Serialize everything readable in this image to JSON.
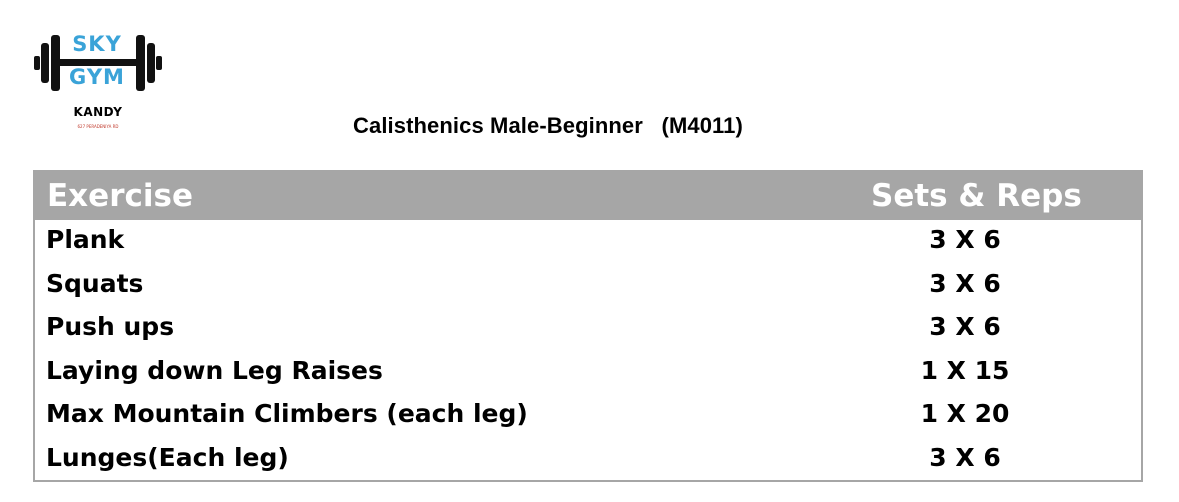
{
  "logo": {
    "line1": "SKY",
    "line2": "GYM",
    "city": "KANDY",
    "subtitle": "627 PERADENIYA RD",
    "accent_color": "#3aa3d8"
  },
  "title": "Calisthenics Male-Beginner   (M4011)",
  "table": {
    "header_color": "#a6a6a6",
    "columns": [
      "Exercise",
      "Sets & Reps"
    ],
    "rows": [
      {
        "exercise": "Plank",
        "sets": "3 X 6"
      },
      {
        "exercise": "Squats",
        "sets": "3 X 6"
      },
      {
        "exercise": "Push ups",
        "sets": "3 X 6"
      },
      {
        "exercise": "Laying down Leg Raises",
        "sets": "1 X 15"
      },
      {
        "exercise": "Max Mountain Climbers (each leg)",
        "sets": "1 X 20"
      },
      {
        "exercise": "Lunges(Each leg)",
        "sets": "3 X 6"
      }
    ]
  }
}
